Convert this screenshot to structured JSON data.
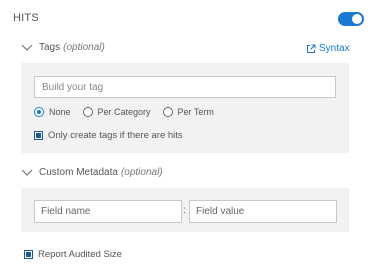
{
  "header": {
    "title": "HITS",
    "toggle_on": true
  },
  "tags": {
    "label": "Tags",
    "optional": "(optional)",
    "syntax_link": "Syntax",
    "input_placeholder": "Build your tag",
    "radio_options": [
      {
        "label": "None",
        "checked": true
      },
      {
        "label": "Per Category",
        "checked": false
      },
      {
        "label": "Per Term",
        "checked": false
      }
    ],
    "only_hits_label": "Only create tags if there are hits",
    "only_hits_checked": true
  },
  "metadata": {
    "label": "Custom Metadata",
    "optional": "(optional)",
    "field_name_placeholder": "Field name",
    "separator": ":",
    "field_value_placeholder": "Field value"
  },
  "report": {
    "label": "Report Audited Size",
    "checked": true
  },
  "colors": {
    "accent": "#1a7ad1",
    "panel": "#f2f2f2"
  }
}
